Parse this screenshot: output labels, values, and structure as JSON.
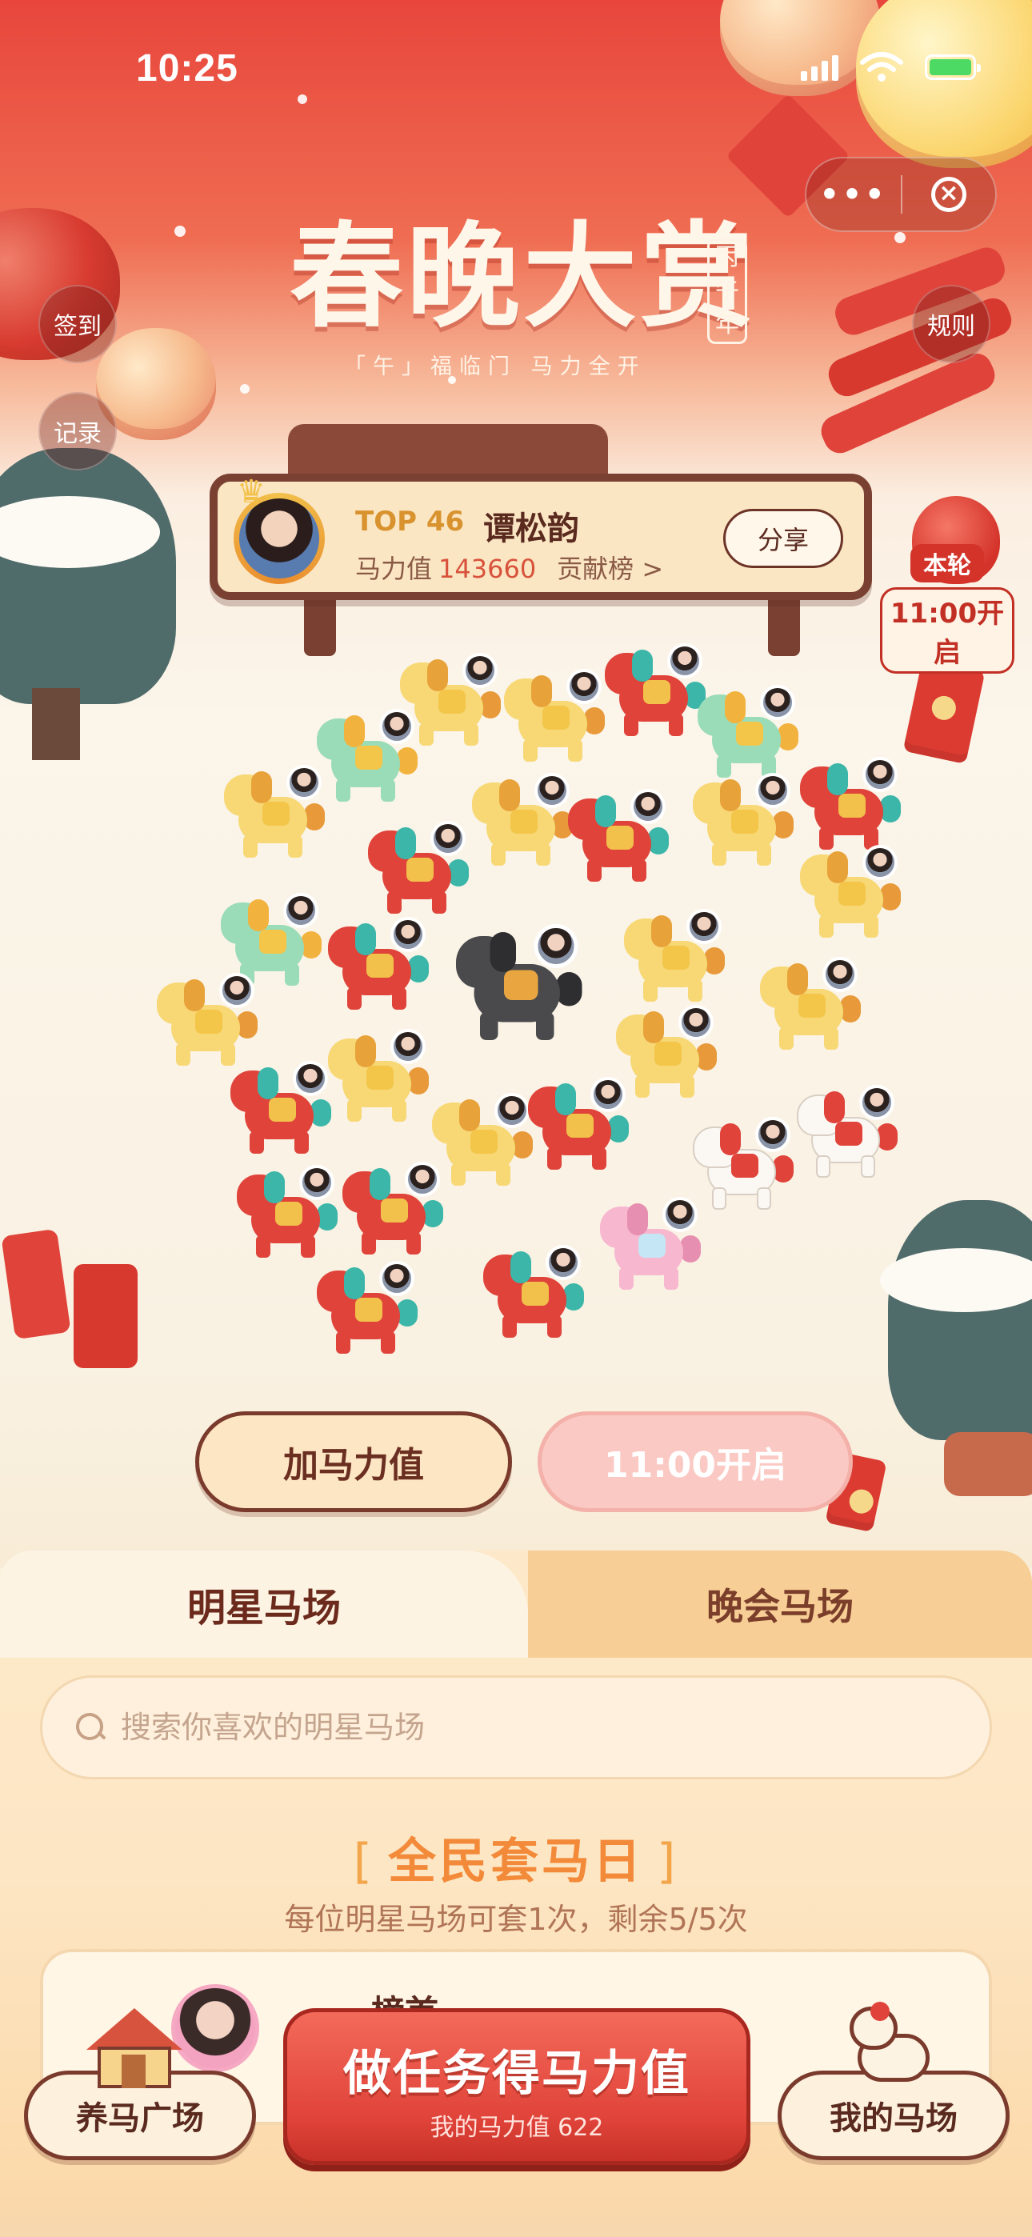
{
  "status_bar": {
    "time": "10:25"
  },
  "header": {
    "title": "春晚大赏",
    "seal": "丙午年",
    "subtitle": "「午」福临门  马力全开",
    "capsule_more": "•••",
    "capsule_close": "×"
  },
  "side_buttons": {
    "checkin": "签到",
    "records": "记录",
    "rules": "规则"
  },
  "leaderboard": {
    "rank": "TOP 46",
    "name": "谭松韵",
    "power_label": "马力值",
    "power_value": "143660",
    "contrib": "贡献榜 >",
    "share": "分享"
  },
  "round_badge": {
    "line1": "本轮",
    "line2": "11:00开启"
  },
  "actions": {
    "add_power": "加马力值",
    "open_time": "11:00开启"
  },
  "tabs": [
    {
      "label": "明星马场",
      "active": true
    },
    {
      "label": "晚会马场",
      "active": false
    }
  ],
  "search": {
    "placeholder": "搜索你喜欢的明星马场"
  },
  "event": {
    "open_bracket": "[",
    "title": "全民套马日",
    "close_bracket": "]",
    "subtitle": "每位明星马场可套1次，剩余5/5次"
  },
  "card": {
    "name": "榜首"
  },
  "bottom_bar": {
    "left": "养马广场",
    "task_title": "做任务得马力值",
    "task_sub": "我的马力值 622",
    "right": "我的马场"
  },
  "colors": {
    "accent_red": "#e1443a",
    "brown": "#7a3a2c",
    "orange_title": "#f28a3a"
  }
}
